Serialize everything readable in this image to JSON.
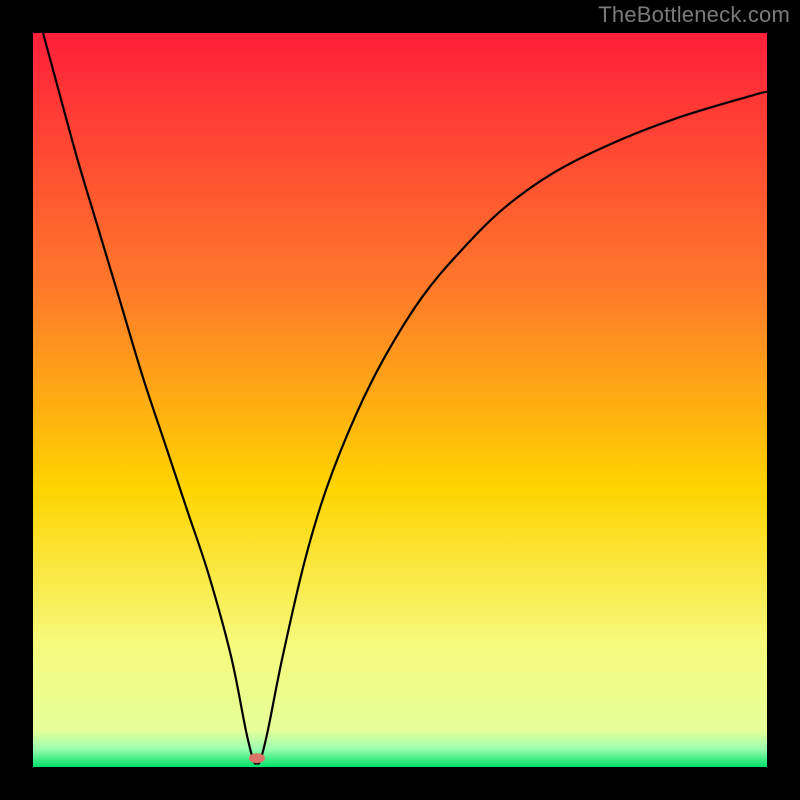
{
  "watermark": "TheBottleneck.com",
  "chart_data": {
    "type": "line",
    "title": "",
    "xlabel": "",
    "ylabel": "",
    "xlim": [
      0,
      100
    ],
    "ylim": [
      0,
      100
    ],
    "background_gradient": {
      "top_color": "#ff1f3a",
      "mid_color": "#ffd400",
      "bottom_band_color": "#00e06a",
      "bottom_band_start_y_pct": 96
    },
    "annotations": {
      "marker": {
        "x_pct": 30.5,
        "y_pct": 98.8,
        "color": "#d9746a"
      }
    },
    "series": [
      {
        "name": "bottleneck-curve",
        "color": "#000000",
        "x": [
          0,
          3,
          6,
          9,
          12,
          15,
          18,
          21,
          24,
          27,
          29,
          30,
          30.5,
          31,
          32,
          34,
          37,
          40,
          44,
          48,
          53,
          58,
          64,
          71,
          79,
          88,
          98,
          100
        ],
        "y": [
          105,
          94,
          83,
          73,
          63,
          53,
          44,
          35,
          26,
          15,
          5,
          1,
          0.5,
          1,
          5,
          15,
          28,
          38,
          48,
          56,
          64,
          70,
          76,
          81,
          85,
          88.5,
          91.5,
          92
        ]
      }
    ]
  }
}
